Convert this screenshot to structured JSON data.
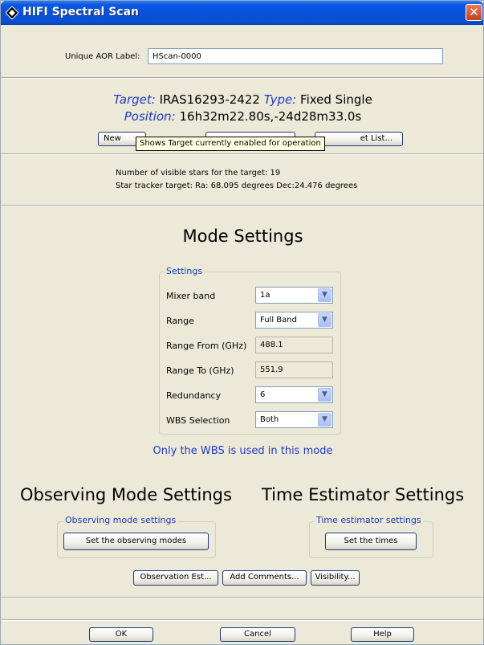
{
  "window": {
    "title": "HIFI Spectral Scan",
    "close_glyph": "✕"
  },
  "aor": {
    "label": "Unique AOR Label:",
    "value": "HScan-0000"
  },
  "target": {
    "target_label": "Target:",
    "target_value": "IRAS16293-2422",
    "type_label": "Type:",
    "type_value": "Fixed Single",
    "position_label": "Position:",
    "position_value": "16h32m22.80s,-24d28m33.0s"
  },
  "target_buttons": {
    "new_label": "New",
    "middle_label": "",
    "list_label": "et List..."
  },
  "tooltip": {
    "text": "Shows Target currently enabled for operation"
  },
  "visibility_info": {
    "stars": "Number of visible stars for the target: 19",
    "tracker": "Star tracker target: Ra: 68.095 degrees Dec:24.476 degrees"
  },
  "mode": {
    "heading": "Mode Settings",
    "group_title": "Settings",
    "rows": {
      "mixer_band": {
        "label": "Mixer band",
        "value": "1a"
      },
      "range": {
        "label": "Range",
        "value": "Full Band"
      },
      "range_from": {
        "label": "Range From (GHz)",
        "value": "488.1"
      },
      "range_to": {
        "label": "Range To (GHz)",
        "value": "551.9"
      },
      "redundancy": {
        "label": "Redundancy",
        "value": "6"
      },
      "wbs": {
        "label": "WBS Selection",
        "value": "Both"
      }
    },
    "note": "Only the WBS is used in this mode"
  },
  "observing": {
    "heading": "Observing Mode Settings",
    "group_title": "Observing mode settings",
    "button": "Set the observing modes"
  },
  "time_estimator": {
    "heading": "Time Estimator Settings",
    "group_title": "Time estimator settings",
    "button": "Set the times"
  },
  "actions": {
    "observation_est": "Observation Est...",
    "add_comments": "Add Comments...",
    "visibility": "Visibility..."
  },
  "footer": {
    "ok": "OK",
    "cancel": "Cancel",
    "help": "Help"
  },
  "icons": {
    "dropdown_arrow": "chevron-down-icon",
    "app": "hifi-diamond-icon",
    "close": "close-icon"
  },
  "colors": {
    "title_bar": "#0a56e1",
    "accent_blue": "#2038c8",
    "close_red": "#c44021"
  }
}
